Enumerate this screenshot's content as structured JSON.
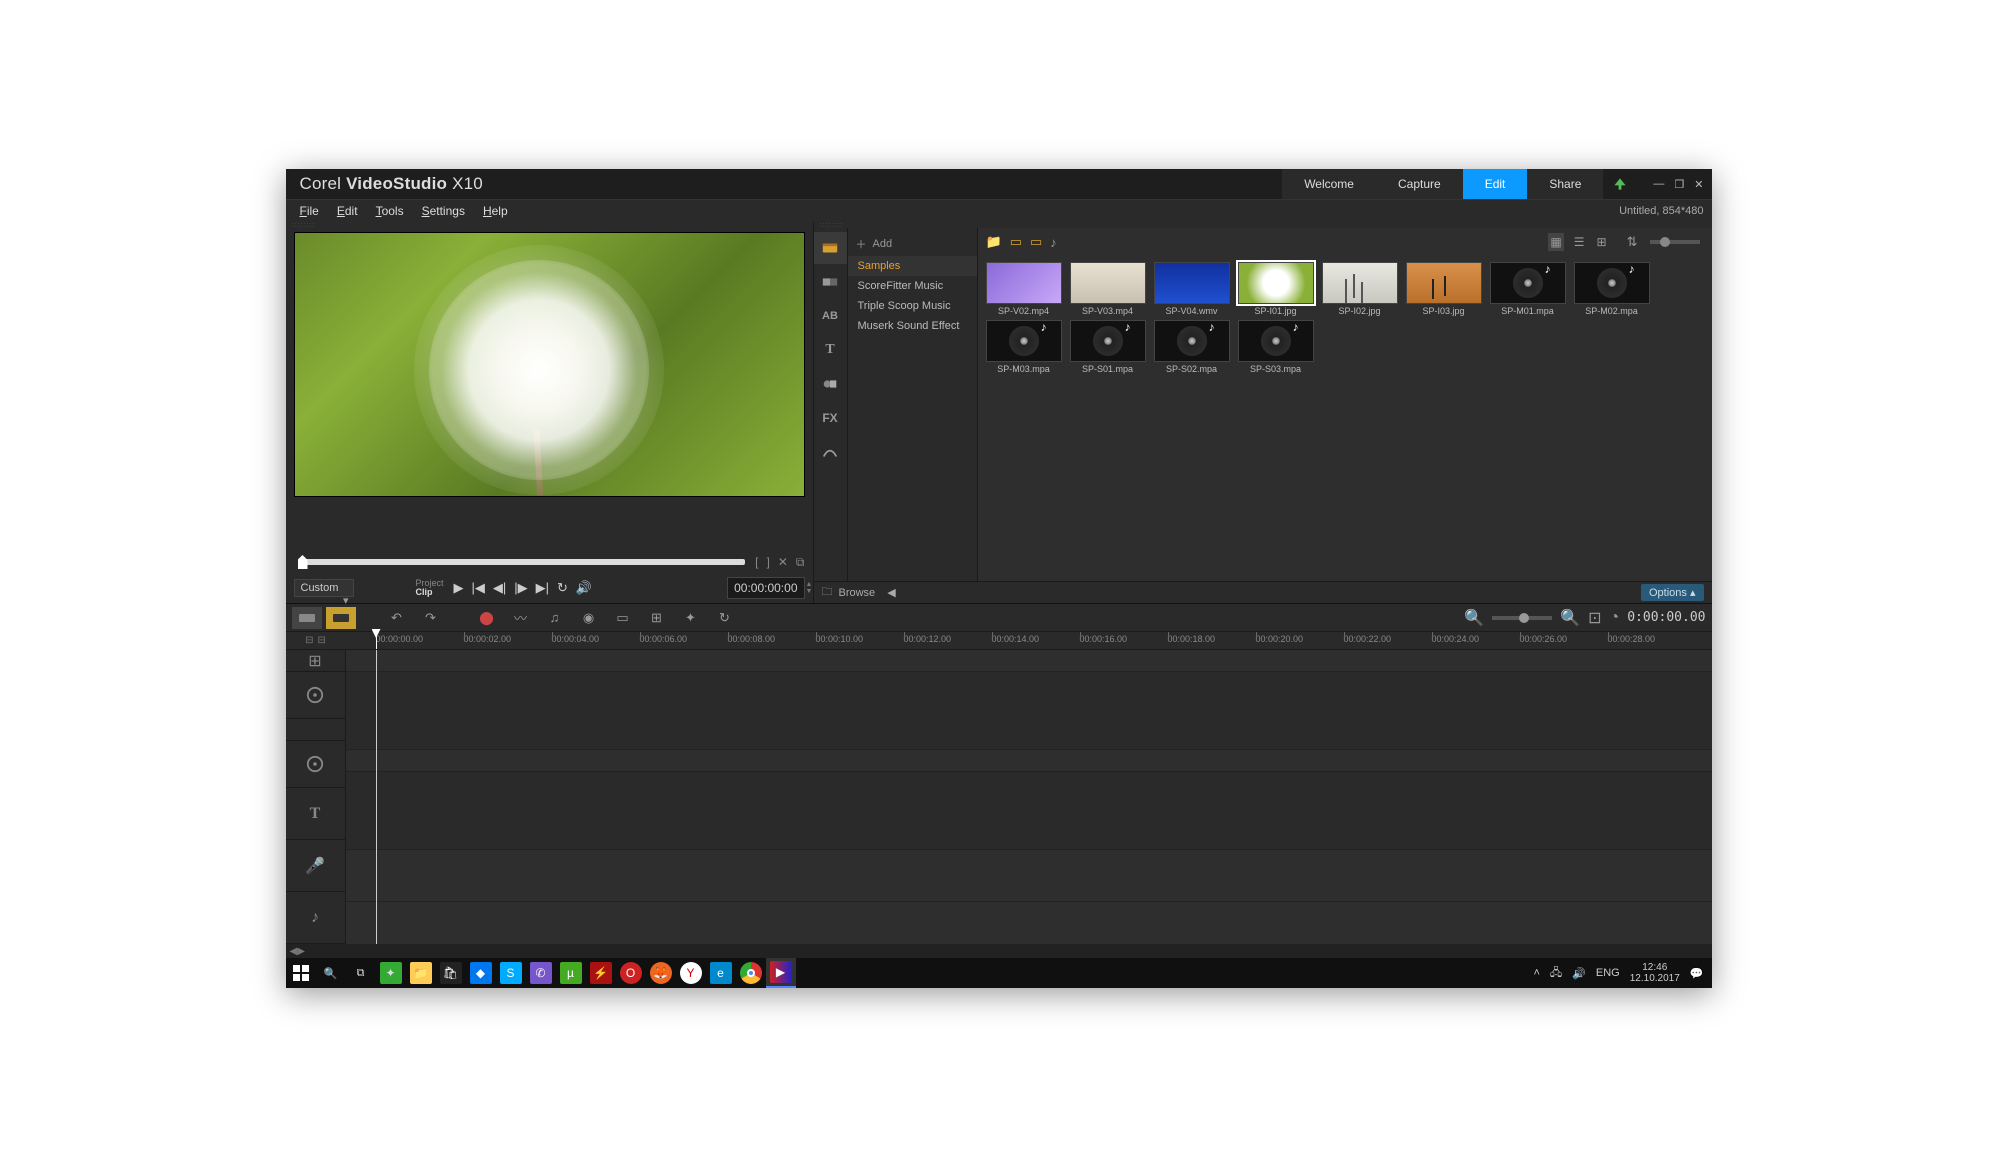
{
  "app": {
    "brand1": "Corel",
    "brand2": "VideoStudio",
    "brand3": "X10"
  },
  "maintabs": {
    "welcome": "Welcome",
    "capture": "Capture",
    "edit": "Edit",
    "share": "Share"
  },
  "menu": {
    "file": "File",
    "edit": "Edit",
    "tools": "Tools",
    "settings": "Settings",
    "help": "Help"
  },
  "project_info": "Untitled, 854*480",
  "preview": {
    "mode": "Custom",
    "label_project": "Project",
    "label_clip": "Clip",
    "timecode": "00:00:00:00"
  },
  "library": {
    "add": "Add",
    "cats": {
      "samples": "Samples",
      "scorefitter": "ScoreFitter Music",
      "triple": "Triple Scoop Music",
      "muserk": "Muserk Sound Effect"
    },
    "items": [
      {
        "name": "SP-V02.mp4",
        "kind": "v1"
      },
      {
        "name": "SP-V03.mp4",
        "kind": "v2"
      },
      {
        "name": "SP-V04.wmv",
        "kind": "v3"
      },
      {
        "name": "SP-I01.jpg",
        "kind": "i1",
        "selected": true
      },
      {
        "name": "SP-I02.jpg",
        "kind": "i2"
      },
      {
        "name": "SP-I03.jpg",
        "kind": "i3"
      },
      {
        "name": "SP-M01.mpa",
        "kind": "audio"
      },
      {
        "name": "SP-M02.mpa",
        "kind": "audio"
      },
      {
        "name": "SP-M03.mpa",
        "kind": "audio"
      },
      {
        "name": "SP-S01.mpa",
        "kind": "audio"
      },
      {
        "name": "SP-S02.mpa",
        "kind": "audio"
      },
      {
        "name": "SP-S03.mpa",
        "kind": "audio"
      }
    ],
    "browse": "Browse",
    "options": "Options"
  },
  "timeline": {
    "timecode": "0:00:00.00",
    "ticks": [
      "00:00:00.00",
      "00:00:02.00",
      "00:00:04.00",
      "00:00:06.00",
      "00:00:08.00",
      "00:00:10.00",
      "00:00:12.00",
      "00:00:14.00",
      "00:00:16.00",
      "00:00:18.00",
      "00:00:20.00",
      "00:00:22.00",
      "00:00:24.00",
      "00:00:26.00",
      "00:00:28.00"
    ]
  },
  "taskbar": {
    "lang": "ENG",
    "time": "12:46",
    "date": "12.10.2017"
  }
}
